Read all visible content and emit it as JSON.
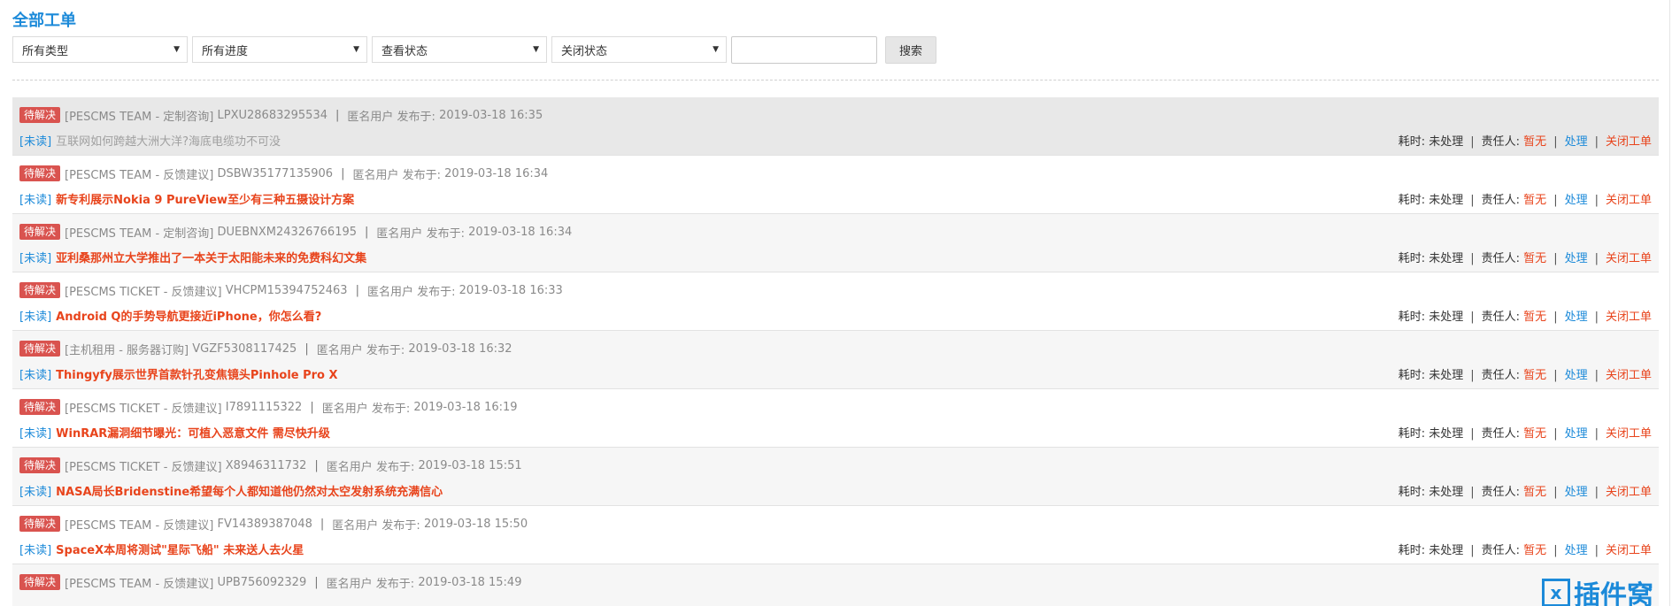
{
  "page_title": "全部工单",
  "filters": {
    "type": "所有类型",
    "progress": "所有进度",
    "view_status": "查看状态",
    "close_status": "关闭状态",
    "search_value": "",
    "search_button": "搜索"
  },
  "labels": {
    "badge": "待解决",
    "unread": "[未读]",
    "author": "匿名用户",
    "published": "发布于:",
    "time_used": "耗时:",
    "time_value": "未处理",
    "assignee_label": "责任人:",
    "assignee_value": "暂无",
    "process": "处理",
    "close": "关闭工单"
  },
  "tickets": [
    {
      "team": "[PESCMS TEAM - 定制咨询]",
      "number": "LPXU28683295534",
      "date": "2019-03-18 16:35",
      "subject": "互联网如何跨越大洲大洋?海底电缆功不可没"
    },
    {
      "team": "[PESCMS TEAM - 反馈建议]",
      "number": "DSBW35177135906",
      "date": "2019-03-18 16:34",
      "subject": "新专利展示Nokia 9 PureView至少有三种五摄设计方案"
    },
    {
      "team": "[PESCMS TEAM - 定制咨询]",
      "number": "DUEBNXM24326766195",
      "date": "2019-03-18 16:34",
      "subject": "亚利桑那州立大学推出了一本关于太阳能未来的免费科幻文集"
    },
    {
      "team": "[PESCMS TICKET - 反馈建议]",
      "number": "VHCPM15394752463",
      "date": "2019-03-18 16:33",
      "subject": "Android Q的手势导航更接近iPhone，你怎么看?"
    },
    {
      "team": "[主机租用 - 服务器订购]",
      "number": "VGZF5308117425",
      "date": "2019-03-18 16:32",
      "subject": "Thingyfy展示世界首款针孔变焦镜头Pinhole Pro X"
    },
    {
      "team": "[PESCMS TICKET - 反馈建议]",
      "number": "I7891115322",
      "date": "2019-03-18 16:19",
      "subject": "WinRAR漏洞细节曝光：可植入恶意文件 需尽快升级"
    },
    {
      "team": "[PESCMS TICKET - 反馈建议]",
      "number": "X8946311732",
      "date": "2019-03-18 15:51",
      "subject": "NASA局长Bridenstine希望每个人都知道他仍然对太空发射系统充满信心"
    },
    {
      "team": "[PESCMS TEAM - 反馈建议]",
      "number": "FV14389387048",
      "date": "2019-03-18 15:50",
      "subject": "SpaceX本周将测试\"星际飞船\" 未来送人去火星"
    },
    {
      "team": "[PESCMS TEAM - 反馈建议]",
      "number": "UPB756092329",
      "date": "2019-03-18 15:49",
      "subject": ""
    }
  ],
  "watermark": "插件窝"
}
